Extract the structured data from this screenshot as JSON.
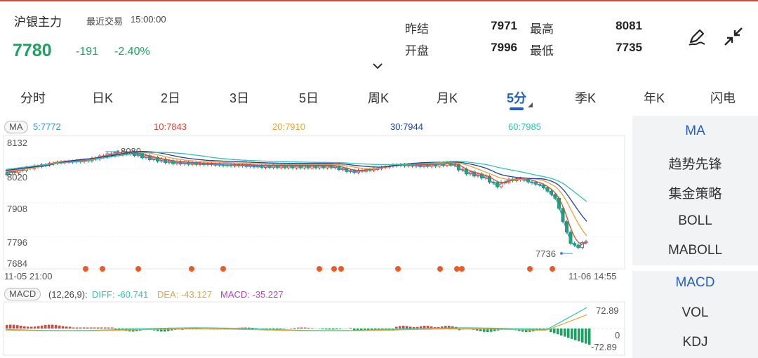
{
  "header": {
    "name": "沪银主力",
    "trade_label": "最近交易",
    "time": "15:00:00",
    "price": "7780",
    "change": "-191",
    "change_pct": "-2.40%",
    "stats": {
      "prev_settle_label": "昨结",
      "prev_settle": "7971",
      "high_label": "最高",
      "high": "8081",
      "open_label": "开盘",
      "open": "7996",
      "low_label": "最低",
      "low": "7735"
    }
  },
  "tabs": [
    "分时",
    "日K",
    "2日",
    "3日",
    "5日",
    "周K",
    "月K",
    "5分",
    "季K",
    "年K",
    "闪电"
  ],
  "active_tab": "5分",
  "ma": {
    "tag": "MA",
    "items": [
      {
        "label": "5:7772",
        "color": "#3d8fe0"
      },
      {
        "label": "10:7843",
        "color": "#d9463c"
      },
      {
        "label": "20:7910",
        "color": "#e8a23a"
      },
      {
        "label": "30:7944",
        "color": "#1f3fa8"
      },
      {
        "label": "60:7985",
        "color": "#2ec4b0"
      }
    ]
  },
  "axis": {
    "y_labels": [
      "8132",
      "8020",
      "7908",
      "7796",
      "7684"
    ],
    "x_start": "11-05 21:00",
    "x_end": "11-06 14:55",
    "high_marker": "8080",
    "low_marker": "7736"
  },
  "macd": {
    "tag": "MACD",
    "params": "(12,26,9):",
    "diff": "DIFF: -60.741",
    "dea": "DEA: -43.127",
    "macd": "MACD: -35.227",
    "diff_color": "#2ec4b0",
    "dea_color": "#e8a23a",
    "macd_color": "#b33fc9",
    "top": "72.89",
    "zero": "0",
    "bottom": "-72.89"
  },
  "panel": {
    "group1": [
      "MA",
      "趋势先锋",
      "集金策略",
      "BOLL",
      "MABOLL"
    ],
    "group2": [
      "MACD",
      "VOL",
      "KDJ"
    ]
  },
  "colors": {
    "up": "#d9463c",
    "down": "#1aa260",
    "accent": "#1e5fcc"
  }
}
